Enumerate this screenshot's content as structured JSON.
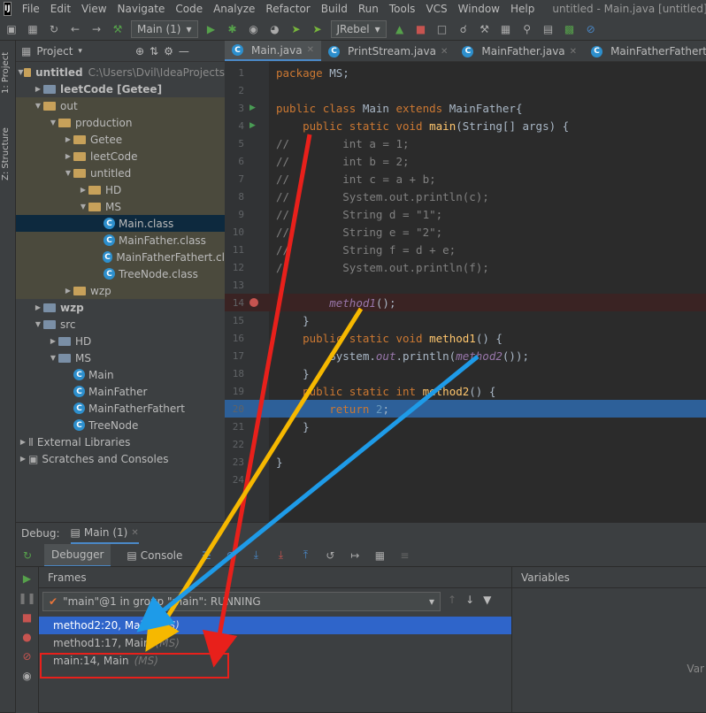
{
  "menubar": {
    "logo": "IJ",
    "items": [
      "File",
      "Edit",
      "View",
      "Navigate",
      "Code",
      "Analyze",
      "Refactor",
      "Build",
      "Run",
      "Tools",
      "VCS",
      "Window",
      "Help"
    ],
    "window_title": "untitled - Main.java [untitled] - Intel"
  },
  "toolbar": {
    "run_config": "Main (1)",
    "jrebel": "JRebel"
  },
  "side_tabs": {
    "project": "1: Project",
    "structure": "Z: Structure"
  },
  "project_panel": {
    "title": "Project",
    "tree": [
      {
        "label": "untitled",
        "extra": "C:\\Users\\Dvil\\IdeaProjects",
        "bold": true,
        "icon": "folder",
        "indent": 0,
        "open": true
      },
      {
        "label": "leetCode [Getee]",
        "bold": true,
        "icon": "module",
        "indent": 1,
        "open": false
      },
      {
        "label": "out",
        "icon": "folder",
        "indent": 1,
        "open": true
      },
      {
        "label": "production",
        "icon": "folder",
        "indent": 2,
        "open": true
      },
      {
        "label": "Getee",
        "icon": "folder",
        "indent": 3,
        "open": false
      },
      {
        "label": "leetCode",
        "icon": "folder",
        "indent": 3,
        "open": false
      },
      {
        "label": "untitled",
        "icon": "folder",
        "indent": 3,
        "open": true
      },
      {
        "label": "HD",
        "icon": "folder",
        "indent": 4,
        "open": false
      },
      {
        "label": "MS",
        "icon": "folder",
        "indent": 4,
        "open": true
      },
      {
        "label": "Main.class",
        "icon": "class",
        "indent": 5
      },
      {
        "label": "MainFather.class",
        "icon": "class",
        "indent": 5
      },
      {
        "label": "MainFatherFathert.cl",
        "icon": "class",
        "indent": 5
      },
      {
        "label": "TreeNode.class",
        "icon": "class",
        "indent": 5
      },
      {
        "label": "wzp",
        "icon": "folder",
        "indent": 3,
        "open": false
      },
      {
        "label": "wzp",
        "bold": true,
        "icon": "module",
        "indent": 1,
        "open": false
      },
      {
        "label": "src",
        "icon": "srcfolder",
        "indent": 1,
        "open": true
      },
      {
        "label": "HD",
        "icon": "package",
        "indent": 2,
        "open": false
      },
      {
        "label": "MS",
        "icon": "package",
        "indent": 2,
        "open": true
      },
      {
        "label": "Main",
        "icon": "class",
        "indent": 3
      },
      {
        "label": "MainFather",
        "icon": "class",
        "indent": 3
      },
      {
        "label": "MainFatherFathert",
        "icon": "class",
        "indent": 3
      },
      {
        "label": "TreeNode",
        "icon": "class",
        "indent": 3
      },
      {
        "label": "External Libraries",
        "icon": "lib",
        "indent": 0,
        "open": false
      },
      {
        "label": "Scratches and Consoles",
        "icon": "scratch",
        "indent": 0,
        "open": false
      }
    ]
  },
  "editor": {
    "tabs": [
      "Main.java",
      "PrintStream.java",
      "MainFather.java",
      "MainFatherFathert.java"
    ],
    "lines": [
      {
        "n": "1",
        "code": "package MS;"
      },
      {
        "n": "2",
        "code": ""
      },
      {
        "n": "3",
        "code": "public class Main extends MainFather{"
      },
      {
        "n": "4",
        "code": "    public static void main(String[] args) {"
      },
      {
        "n": "5",
        "code": "//        int a = 1;"
      },
      {
        "n": "6",
        "code": "//        int b = 2;"
      },
      {
        "n": "7",
        "code": "//        int c = a + b;"
      },
      {
        "n": "8",
        "code": "//        System.out.println(c);"
      },
      {
        "n": "9",
        "code": "//        String d = \"1\";"
      },
      {
        "n": "10",
        "code": "//        String e = \"2\";"
      },
      {
        "n": "11",
        "code": "//        String f = d + e;"
      },
      {
        "n": "12",
        "code": "//        System.out.println(f);"
      },
      {
        "n": "13",
        "code": ""
      },
      {
        "n": "14",
        "code": "        method1();"
      },
      {
        "n": "15",
        "code": "    }"
      },
      {
        "n": "16",
        "code": "    public static void method1() {"
      },
      {
        "n": "17",
        "code": "        System.out.println(method2());"
      },
      {
        "n": "18",
        "code": "    }"
      },
      {
        "n": "19",
        "code": "    public static int method2() {"
      },
      {
        "n": "20",
        "code": "        return 2;"
      },
      {
        "n": "21",
        "code": "    }"
      },
      {
        "n": "22",
        "code": ""
      },
      {
        "n": "23",
        "code": "}"
      },
      {
        "n": "24",
        "code": ""
      }
    ]
  },
  "debug": {
    "label": "Debug:",
    "session_tab": "Main (1)",
    "tabs": [
      "Debugger",
      "Console"
    ],
    "frames_label": "Frames",
    "variables_label": "Variables",
    "variables_cut": "Var",
    "thread": "\"main\"@1 in group \"main\": RUNNING",
    "frames": [
      {
        "method": "method2:20, Main",
        "pkg": "(MS)"
      },
      {
        "method": "method1:17, Main",
        "pkg": "(MS)"
      },
      {
        "method": "main:14, Main",
        "pkg": "(MS)"
      }
    ]
  },
  "annotation_colors": {
    "red": "#e8201b",
    "yellow": "#f6b800",
    "blue": "#1e9be8",
    "selection": "#2f65ca"
  }
}
